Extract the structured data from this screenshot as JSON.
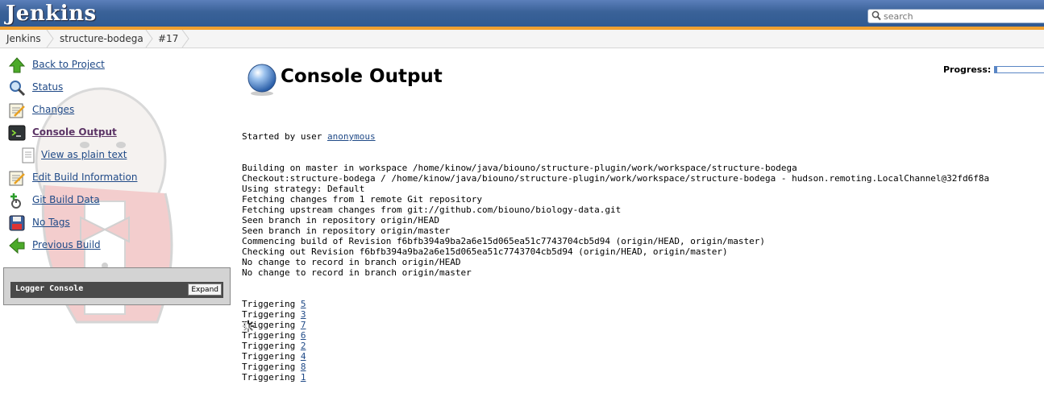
{
  "header": {
    "logo": "Jenkins",
    "search_placeholder": "search"
  },
  "breadcrumbs": [
    {
      "label": "Jenkins"
    },
    {
      "label": "structure-bodega"
    },
    {
      "label": "#17"
    }
  ],
  "sidebar": {
    "tasks": [
      {
        "label": "Back to Project",
        "icon": "up-arrow-icon"
      },
      {
        "label": "Status",
        "icon": "magnifier-icon"
      },
      {
        "label": "Changes",
        "icon": "notepad-icon"
      },
      {
        "label": "Console Output",
        "icon": "terminal-icon"
      },
      {
        "label": "View as plain text",
        "icon": "document-icon"
      },
      {
        "label": "Edit Build Information",
        "icon": "notepad-icon"
      },
      {
        "label": "Git Build Data",
        "icon": "git-icon"
      },
      {
        "label": "No Tags",
        "icon": "save-icon"
      },
      {
        "label": "Previous Build",
        "icon": "left-arrow-icon"
      }
    ],
    "logger": {
      "title": "Logger Console",
      "expand_label": "Expand"
    }
  },
  "main": {
    "title": "Console Output",
    "progress_label": "Progress:",
    "progress": 0.04,
    "console": {
      "started_prefix": "Started by user ",
      "started_user": "anonymous",
      "lines": [
        "Building on master in workspace /home/kinow/java/biouno/structure-plugin/work/workspace/structure-bodega",
        "Checkout:structure-bodega / /home/kinow/java/biouno/structure-plugin/work/workspace/structure-bodega - hudson.remoting.LocalChannel@32fd6f8a",
        "Using strategy: Default",
        "Fetching changes from 1 remote Git repository",
        "Fetching upstream changes from git://github.com/biouno/biology-data.git",
        "Seen branch in repository origin/HEAD",
        "Seen branch in repository origin/master",
        "Commencing build of Revision f6bfb394a9ba2a6e15d065ea51c7743704cb5d94 (origin/HEAD, origin/master)",
        "Checking out Revision f6bfb394a9ba2a6e15d065ea51c7743704cb5d94 (origin/HEAD, origin/master)",
        "No change to record in branch origin/HEAD",
        "No change to record in branch origin/master"
      ],
      "trigger_prefix": "Triggering ",
      "triggers": [
        "5",
        "3",
        "7",
        "6",
        "2",
        "4",
        "8",
        "1"
      ]
    }
  },
  "colors": {
    "header": "#3a6298",
    "header_underline": "#f0a030",
    "link": "#204a87",
    "current_link": "#5c3566"
  }
}
